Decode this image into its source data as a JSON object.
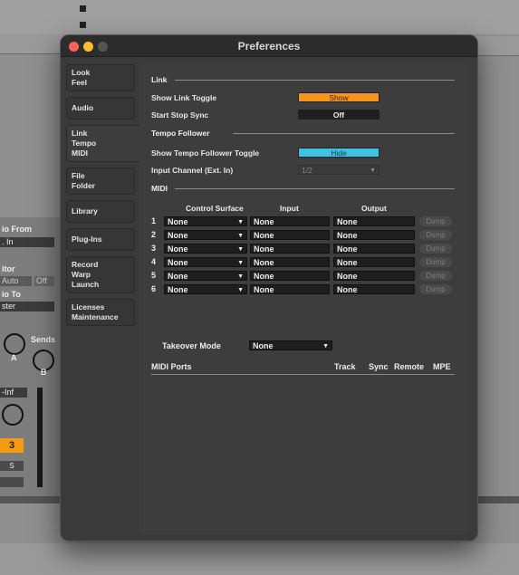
{
  "background": {
    "left_labels": {
      "audio_from": "io From",
      "in_value": ". In",
      "monitor": "itor",
      "auto": "Auto",
      "off": "Off",
      "audio_to": "io To",
      "master": "ster",
      "sends": "Sends",
      "knob_a": "A",
      "knob_b": "B",
      "volume": "-Inf",
      "track_number": "3",
      "solo": "S"
    }
  },
  "window": {
    "title": "Preferences"
  },
  "sidebar": {
    "tabs": [
      {
        "lines": [
          "Look",
          "Feel"
        ]
      },
      {
        "lines": [
          "Audio"
        ]
      },
      {
        "lines": [
          "Link",
          "Tempo",
          "MIDI"
        ]
      },
      {
        "lines": [
          "File",
          "Folder"
        ]
      },
      {
        "lines": [
          "Library"
        ]
      },
      {
        "lines": [
          "Plug-Ins"
        ]
      },
      {
        "lines": [
          "Record",
          "Warp",
          "Launch"
        ]
      },
      {
        "lines": [
          "Licenses",
          "Maintenance"
        ]
      }
    ],
    "active_index": 2
  },
  "link": {
    "heading": "Link",
    "show_link_toggle_label": "Show Link Toggle",
    "show_link_toggle_value": "Show",
    "start_stop_sync_label": "Start Stop Sync",
    "start_stop_sync_value": "Off"
  },
  "tempo": {
    "heading": "Tempo Follower",
    "show_toggle_label": "Show Tempo Follower Toggle",
    "show_toggle_value": "Hide",
    "input_channel_label": "Input Channel (Ext. In)",
    "input_channel_value": "1/2"
  },
  "midi": {
    "heading": "MIDI",
    "col_control_surface": "Control Surface",
    "col_input": "Input",
    "col_output": "Output",
    "rows": [
      {
        "num": "1",
        "surface": "None",
        "input": "None",
        "output": "None",
        "dump": "Dump"
      },
      {
        "num": "2",
        "surface": "None",
        "input": "None",
        "output": "None",
        "dump": "Dump"
      },
      {
        "num": "3",
        "surface": "None",
        "input": "None",
        "output": "None",
        "dump": "Dump"
      },
      {
        "num": "4",
        "surface": "None",
        "input": "None",
        "output": "None",
        "dump": "Dump"
      },
      {
        "num": "5",
        "surface": "None",
        "input": "None",
        "output": "None",
        "dump": "Dump"
      },
      {
        "num": "6",
        "surface": "None",
        "input": "None",
        "output": "None",
        "dump": "Dump"
      }
    ],
    "takeover_label": "Takeover Mode",
    "takeover_value": "None",
    "ports_header": {
      "title": "MIDI Ports",
      "track": "Track",
      "sync": "Sync",
      "remote": "Remote",
      "mpe": "MPE"
    }
  },
  "colors": {
    "orange": "#f7941d",
    "cyan": "#3dc3e6",
    "window_bg": "#3a3a3a"
  }
}
